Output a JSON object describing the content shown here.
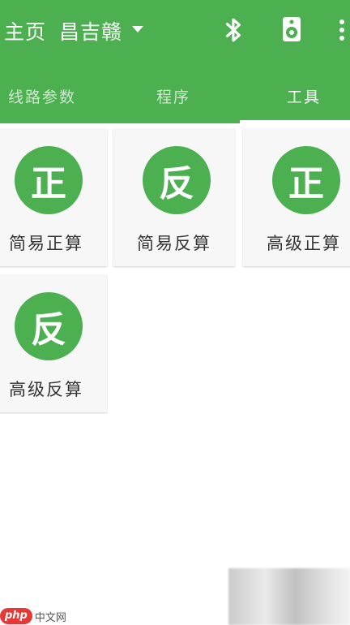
{
  "appbar": {
    "home_label": "主页",
    "route_name": "昌吉赣",
    "background_color": "#4CAF50",
    "icons": {
      "bluetooth": "bluetooth-icon",
      "speaker": "speaker-icon",
      "overflow": "more-vert-icon",
      "dropdown": "caret-down-icon"
    }
  },
  "tabs": [
    {
      "label": "线路参数",
      "selected": false
    },
    {
      "label": "程序",
      "selected": false
    },
    {
      "label": "工具",
      "selected": true
    }
  ],
  "tools": [
    {
      "badge": "正",
      "label": "简易正算"
    },
    {
      "badge": "反",
      "label": "简易反算"
    },
    {
      "badge": "正",
      "label": "高级正算"
    },
    {
      "badge": "反",
      "label": "高级反算"
    }
  ],
  "watermark": {
    "logo_text": "php",
    "site_text": "中文网"
  }
}
